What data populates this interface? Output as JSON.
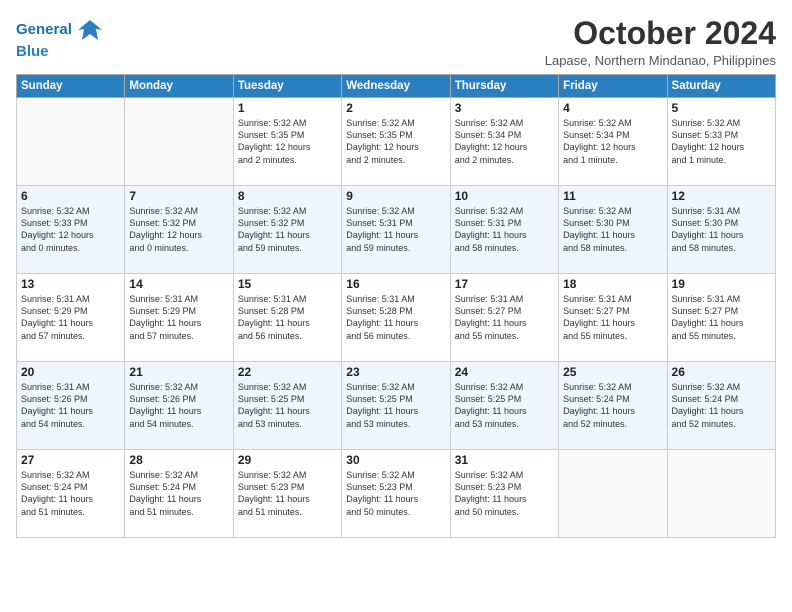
{
  "logo": {
    "line1": "General",
    "line2": "Blue"
  },
  "header": {
    "month": "October 2024",
    "location": "Lapase, Northern Mindanao, Philippines"
  },
  "weekdays": [
    "Sunday",
    "Monday",
    "Tuesday",
    "Wednesday",
    "Thursday",
    "Friday",
    "Saturday"
  ],
  "weeks": [
    [
      {
        "day": "",
        "text": ""
      },
      {
        "day": "",
        "text": ""
      },
      {
        "day": "1",
        "text": "Sunrise: 5:32 AM\nSunset: 5:35 PM\nDaylight: 12 hours\nand 2 minutes."
      },
      {
        "day": "2",
        "text": "Sunrise: 5:32 AM\nSunset: 5:35 PM\nDaylight: 12 hours\nand 2 minutes."
      },
      {
        "day": "3",
        "text": "Sunrise: 5:32 AM\nSunset: 5:34 PM\nDaylight: 12 hours\nand 2 minutes."
      },
      {
        "day": "4",
        "text": "Sunrise: 5:32 AM\nSunset: 5:34 PM\nDaylight: 12 hours\nand 1 minute."
      },
      {
        "day": "5",
        "text": "Sunrise: 5:32 AM\nSunset: 5:33 PM\nDaylight: 12 hours\nand 1 minute."
      }
    ],
    [
      {
        "day": "6",
        "text": "Sunrise: 5:32 AM\nSunset: 5:33 PM\nDaylight: 12 hours\nand 0 minutes."
      },
      {
        "day": "7",
        "text": "Sunrise: 5:32 AM\nSunset: 5:32 PM\nDaylight: 12 hours\nand 0 minutes."
      },
      {
        "day": "8",
        "text": "Sunrise: 5:32 AM\nSunset: 5:32 PM\nDaylight: 11 hours\nand 59 minutes."
      },
      {
        "day": "9",
        "text": "Sunrise: 5:32 AM\nSunset: 5:31 PM\nDaylight: 11 hours\nand 59 minutes."
      },
      {
        "day": "10",
        "text": "Sunrise: 5:32 AM\nSunset: 5:31 PM\nDaylight: 11 hours\nand 58 minutes."
      },
      {
        "day": "11",
        "text": "Sunrise: 5:32 AM\nSunset: 5:30 PM\nDaylight: 11 hours\nand 58 minutes."
      },
      {
        "day": "12",
        "text": "Sunrise: 5:31 AM\nSunset: 5:30 PM\nDaylight: 11 hours\nand 58 minutes."
      }
    ],
    [
      {
        "day": "13",
        "text": "Sunrise: 5:31 AM\nSunset: 5:29 PM\nDaylight: 11 hours\nand 57 minutes."
      },
      {
        "day": "14",
        "text": "Sunrise: 5:31 AM\nSunset: 5:29 PM\nDaylight: 11 hours\nand 57 minutes."
      },
      {
        "day": "15",
        "text": "Sunrise: 5:31 AM\nSunset: 5:28 PM\nDaylight: 11 hours\nand 56 minutes."
      },
      {
        "day": "16",
        "text": "Sunrise: 5:31 AM\nSunset: 5:28 PM\nDaylight: 11 hours\nand 56 minutes."
      },
      {
        "day": "17",
        "text": "Sunrise: 5:31 AM\nSunset: 5:27 PM\nDaylight: 11 hours\nand 55 minutes."
      },
      {
        "day": "18",
        "text": "Sunrise: 5:31 AM\nSunset: 5:27 PM\nDaylight: 11 hours\nand 55 minutes."
      },
      {
        "day": "19",
        "text": "Sunrise: 5:31 AM\nSunset: 5:27 PM\nDaylight: 11 hours\nand 55 minutes."
      }
    ],
    [
      {
        "day": "20",
        "text": "Sunrise: 5:31 AM\nSunset: 5:26 PM\nDaylight: 11 hours\nand 54 minutes."
      },
      {
        "day": "21",
        "text": "Sunrise: 5:32 AM\nSunset: 5:26 PM\nDaylight: 11 hours\nand 54 minutes."
      },
      {
        "day": "22",
        "text": "Sunrise: 5:32 AM\nSunset: 5:25 PM\nDaylight: 11 hours\nand 53 minutes."
      },
      {
        "day": "23",
        "text": "Sunrise: 5:32 AM\nSunset: 5:25 PM\nDaylight: 11 hours\nand 53 minutes."
      },
      {
        "day": "24",
        "text": "Sunrise: 5:32 AM\nSunset: 5:25 PM\nDaylight: 11 hours\nand 53 minutes."
      },
      {
        "day": "25",
        "text": "Sunrise: 5:32 AM\nSunset: 5:24 PM\nDaylight: 11 hours\nand 52 minutes."
      },
      {
        "day": "26",
        "text": "Sunrise: 5:32 AM\nSunset: 5:24 PM\nDaylight: 11 hours\nand 52 minutes."
      }
    ],
    [
      {
        "day": "27",
        "text": "Sunrise: 5:32 AM\nSunset: 5:24 PM\nDaylight: 11 hours\nand 51 minutes."
      },
      {
        "day": "28",
        "text": "Sunrise: 5:32 AM\nSunset: 5:24 PM\nDaylight: 11 hours\nand 51 minutes."
      },
      {
        "day": "29",
        "text": "Sunrise: 5:32 AM\nSunset: 5:23 PM\nDaylight: 11 hours\nand 51 minutes."
      },
      {
        "day": "30",
        "text": "Sunrise: 5:32 AM\nSunset: 5:23 PM\nDaylight: 11 hours\nand 50 minutes."
      },
      {
        "day": "31",
        "text": "Sunrise: 5:32 AM\nSunset: 5:23 PM\nDaylight: 11 hours\nand 50 minutes."
      },
      {
        "day": "",
        "text": ""
      },
      {
        "day": "",
        "text": ""
      }
    ]
  ]
}
